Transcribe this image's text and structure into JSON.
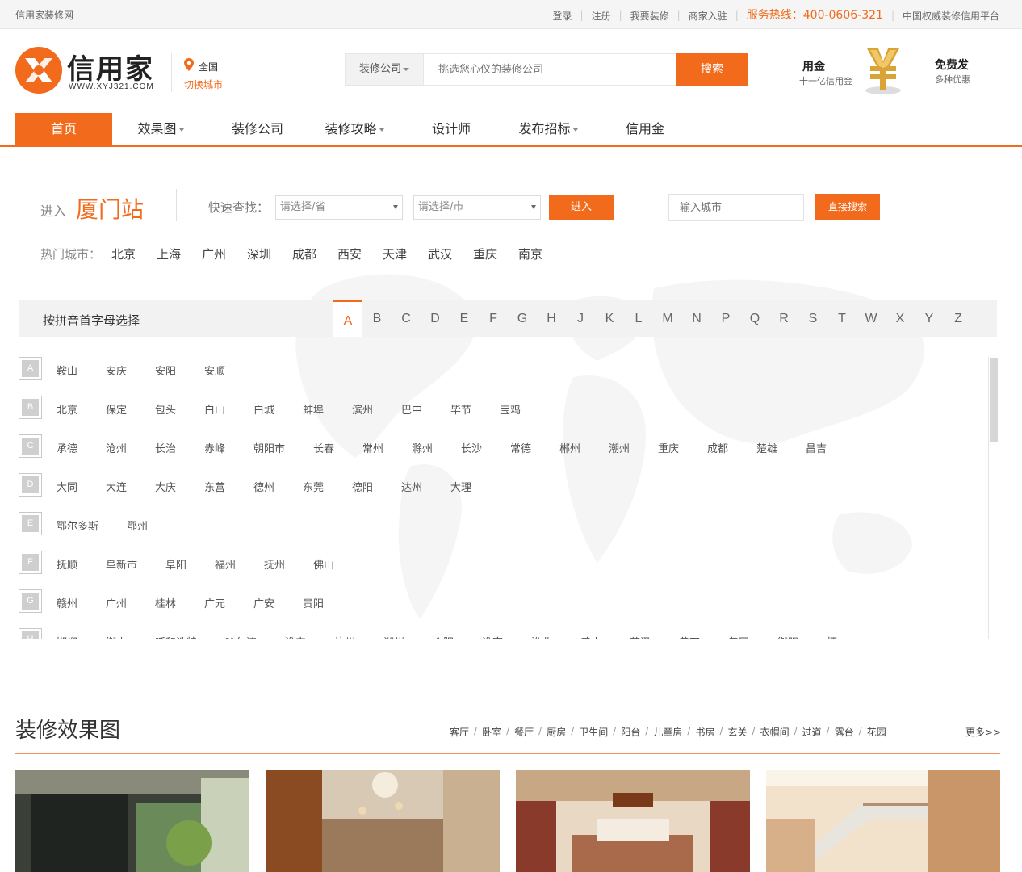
{
  "topbar": {
    "site_name": "信用家装修网",
    "login": "登录",
    "register": "注册",
    "want_decorate": "我要装修",
    "merchant_join": "商家入驻",
    "hotline": "服务热线：400-0606-321",
    "slogan": "中国权威装修信用平台"
  },
  "header": {
    "brand": "信用家",
    "url": "WWW.XYJ321.COM",
    "city_all": "全国",
    "city_switch": "切换城市",
    "search_category": "装修公司",
    "search_placeholder": "挑选您心仪的装修公司",
    "search_button": "搜索",
    "promo_title": "用金",
    "promo_sub": "十一亿信用金",
    "promo_free": "免费发",
    "promo_free_sub": "多种优惠"
  },
  "nav": {
    "items": [
      {
        "label": "首页"
      },
      {
        "label": "效果图"
      },
      {
        "label": "装修公司"
      },
      {
        "label": "装修攻略"
      },
      {
        "label": "设计师"
      },
      {
        "label": "发布招标"
      },
      {
        "label": "信用金"
      }
    ]
  },
  "city": {
    "enter_label": "进入",
    "station": "厦门站",
    "quick_label": "快速查找：",
    "province_placeholder": "请选择/省",
    "city_placeholder": "请选择/市",
    "enter_button": "进入",
    "input_placeholder": "输入城市",
    "direct_button": "直接搜索",
    "hot_label": "热门城市：",
    "hot_cities": [
      "北京",
      "上海",
      "广州",
      "深圳",
      "成都",
      "西安",
      "天津",
      "武汉",
      "重庆",
      "南京"
    ],
    "pinyin_title": "按拼音首字母选择",
    "letters": [
      "A",
      "B",
      "C",
      "D",
      "E",
      "F",
      "G",
      "H",
      "J",
      "K",
      "L",
      "M",
      "N",
      "P",
      "Q",
      "R",
      "S",
      "T",
      "W",
      "X",
      "Y",
      "Z"
    ],
    "active_letter": "A",
    "rows": [
      {
        "letter": "A",
        "cities": [
          "鞍山",
          "安庆",
          "安阳",
          "安顺"
        ]
      },
      {
        "letter": "B",
        "cities": [
          "北京",
          "保定",
          "包头",
          "白山",
          "白城",
          "蚌埠",
          "滨州",
          "巴中",
          "毕节",
          "宝鸡"
        ]
      },
      {
        "letter": "C",
        "cities": [
          "承德",
          "沧州",
          "长治",
          "赤峰",
          "朝阳市",
          "长春",
          "常州",
          "滁州",
          "长沙",
          "常德",
          "郴州",
          "潮州",
          "重庆",
          "成都",
          "楚雄",
          "昌吉"
        ]
      },
      {
        "letter": "D",
        "cities": [
          "大同",
          "大连",
          "大庆",
          "东营",
          "德州",
          "东莞",
          "德阳",
          "达州",
          "大理"
        ]
      },
      {
        "letter": "E",
        "cities": [
          "鄂尔多斯",
          "鄂州"
        ]
      },
      {
        "letter": "F",
        "cities": [
          "抚顺",
          "阜新市",
          "阜阳",
          "福州",
          "抚州",
          "佛山"
        ]
      },
      {
        "letter": "G",
        "cities": [
          "赣州",
          "广州",
          "桂林",
          "广元",
          "广安",
          "贵阳"
        ]
      },
      {
        "letter": "H",
        "cities": [
          "邯郸",
          "衡水",
          "呼和浩特",
          "哈尔滨",
          "淮安",
          "杭州",
          "湖州",
          "合肥",
          "淮南",
          "淮北",
          "黄山",
          "菏泽",
          "黄石",
          "黄冈",
          "衡阳",
          "怀"
        ]
      }
    ]
  },
  "gallery": {
    "title": "装修效果图",
    "categories": [
      "客厅",
      "卧室",
      "餐厅",
      "厨房",
      "卫生间",
      "阳台",
      "儿童房",
      "书房",
      "玄关",
      "衣帽间",
      "过道",
      "露台",
      "花园"
    ],
    "more": "更多>>"
  },
  "colors": {
    "accent": "#f26a1b"
  }
}
